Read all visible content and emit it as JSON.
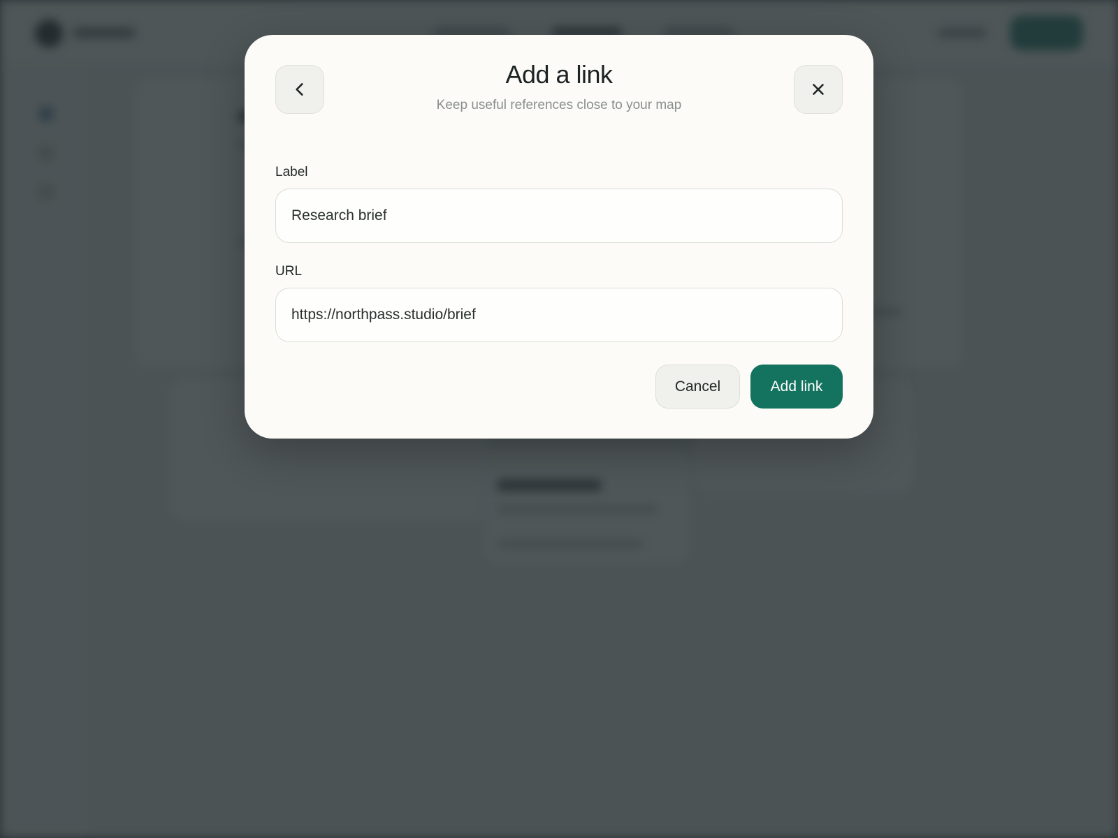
{
  "modal": {
    "title": "Add a link",
    "subtitle": "Keep useful references close to your map",
    "back_icon": "chevron-left-icon",
    "close_icon": "close-icon",
    "fields": {
      "label": {
        "label": "Label",
        "value": "Research brief"
      },
      "url": {
        "label": "URL",
        "value": "https://northpass.studio/brief"
      }
    },
    "actions": {
      "cancel_label": "Cancel",
      "submit_label": "Add link"
    }
  },
  "colors": {
    "accent": "#14735f",
    "modal_background": "#fcfbf8",
    "scrim": "#262e32"
  }
}
